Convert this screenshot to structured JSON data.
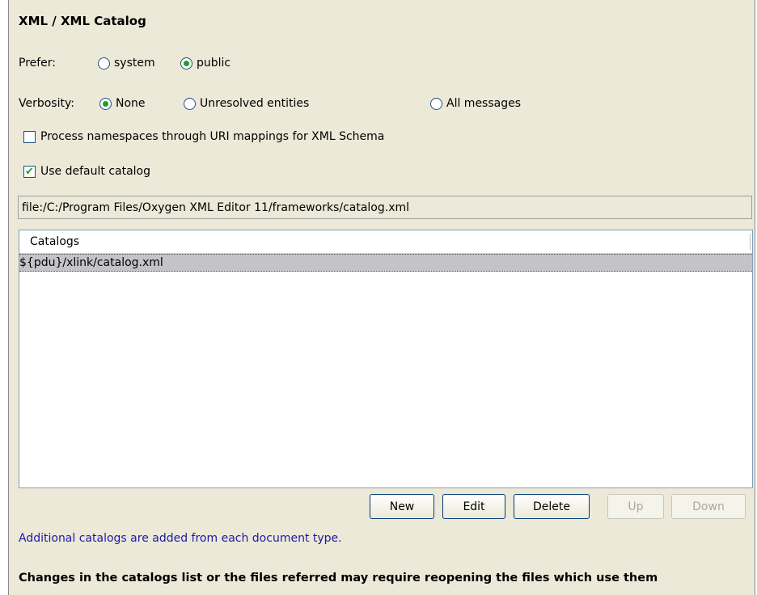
{
  "title": "XML / XML Catalog",
  "prefer": {
    "label": "Prefer:",
    "options": [
      "system",
      "public"
    ],
    "selected": "public"
  },
  "verbosity": {
    "label": "Verbosity:",
    "options": [
      "None",
      "Unresolved entities",
      "All messages"
    ],
    "selected": "None"
  },
  "namespaces_checkbox": {
    "label": "Process namespaces through URI mappings for XML Schema",
    "checked": false
  },
  "default_catalog_checkbox": {
    "label": "Use default catalog",
    "checked": true
  },
  "default_catalog_path": "file:/C:/Program Files/Oxygen XML Editor 11/frameworks/catalog.xml",
  "catalogs_table": {
    "header": "Catalogs",
    "rows": [
      "${pdu}/xlink/catalog.xml"
    ]
  },
  "buttons": {
    "new": "New",
    "edit": "Edit",
    "delete": "Delete",
    "up": "Up",
    "down": "Down"
  },
  "info_text": "Additional catalogs are added from each document type.",
  "note_text": "Changes in the catalogs list or the files referred may require reopening the files which use them",
  "colors": {
    "panel": "#ece9d8",
    "radio_dot": "#21a121",
    "info_text": "#1a1aa8"
  }
}
